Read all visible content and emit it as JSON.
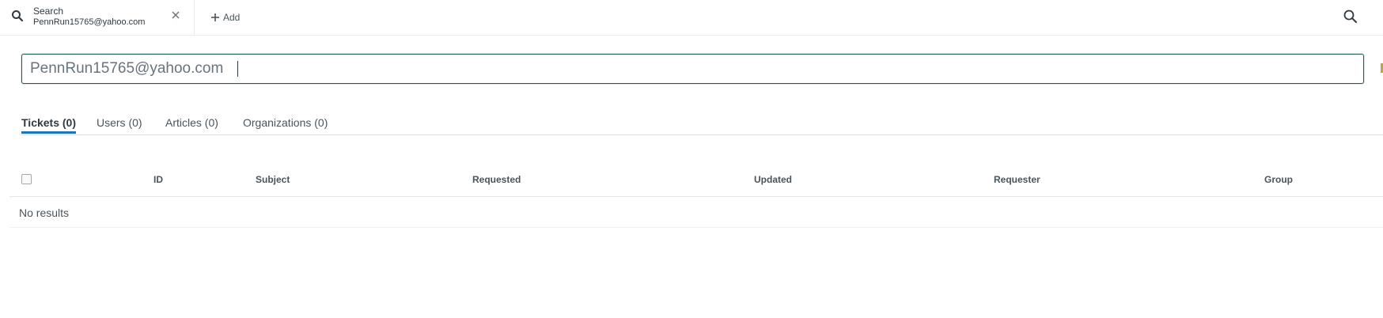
{
  "top_tab": {
    "title": "Search",
    "subtitle": "PennRun15765@yahoo.com",
    "icon": "search-icon",
    "close_icon": "close-icon"
  },
  "add_tab": {
    "label": "Add",
    "icon": "plus-icon"
  },
  "top_search": {
    "icon": "search-icon"
  },
  "search": {
    "value": "PennRun15765@yahoo.com"
  },
  "result_tabs": [
    {
      "label": "Tickets (0)",
      "active": true
    },
    {
      "label": "Users (0)",
      "active": false
    },
    {
      "label": "Articles (0)",
      "active": false
    },
    {
      "label": "Organizations (0)",
      "active": false
    }
  ],
  "table": {
    "columns": [
      "ID",
      "Subject",
      "Requested",
      "Updated",
      "Requester",
      "Group"
    ],
    "empty_message": "No results"
  },
  "colors": {
    "accent": "#1f73b7",
    "input_border": "#1f5f57",
    "text": "#2f3941"
  }
}
